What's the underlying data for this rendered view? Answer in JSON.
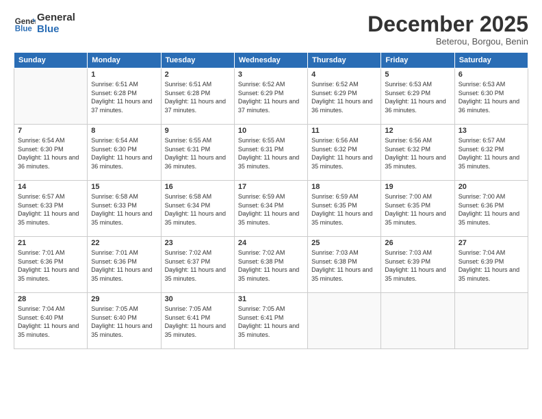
{
  "logo": {
    "general": "General",
    "blue": "Blue"
  },
  "header": {
    "month": "December 2025",
    "location": "Beterou, Borgou, Benin"
  },
  "days_of_week": [
    "Sunday",
    "Monday",
    "Tuesday",
    "Wednesday",
    "Thursday",
    "Friday",
    "Saturday"
  ],
  "weeks": [
    [
      {
        "day": "",
        "info": ""
      },
      {
        "day": "1",
        "info": "Sunrise: 6:51 AM\nSunset: 6:28 PM\nDaylight: 11 hours and 37 minutes."
      },
      {
        "day": "2",
        "info": "Sunrise: 6:51 AM\nSunset: 6:28 PM\nDaylight: 11 hours and 37 minutes."
      },
      {
        "day": "3",
        "info": "Sunrise: 6:52 AM\nSunset: 6:29 PM\nDaylight: 11 hours and 37 minutes."
      },
      {
        "day": "4",
        "info": "Sunrise: 6:52 AM\nSunset: 6:29 PM\nDaylight: 11 hours and 36 minutes."
      },
      {
        "day": "5",
        "info": "Sunrise: 6:53 AM\nSunset: 6:29 PM\nDaylight: 11 hours and 36 minutes."
      },
      {
        "day": "6",
        "info": "Sunrise: 6:53 AM\nSunset: 6:30 PM\nDaylight: 11 hours and 36 minutes."
      }
    ],
    [
      {
        "day": "7",
        "info": "Sunrise: 6:54 AM\nSunset: 6:30 PM\nDaylight: 11 hours and 36 minutes."
      },
      {
        "day": "8",
        "info": "Sunrise: 6:54 AM\nSunset: 6:30 PM\nDaylight: 11 hours and 36 minutes."
      },
      {
        "day": "9",
        "info": "Sunrise: 6:55 AM\nSunset: 6:31 PM\nDaylight: 11 hours and 36 minutes."
      },
      {
        "day": "10",
        "info": "Sunrise: 6:55 AM\nSunset: 6:31 PM\nDaylight: 11 hours and 35 minutes."
      },
      {
        "day": "11",
        "info": "Sunrise: 6:56 AM\nSunset: 6:32 PM\nDaylight: 11 hours and 35 minutes."
      },
      {
        "day": "12",
        "info": "Sunrise: 6:56 AM\nSunset: 6:32 PM\nDaylight: 11 hours and 35 minutes."
      },
      {
        "day": "13",
        "info": "Sunrise: 6:57 AM\nSunset: 6:32 PM\nDaylight: 11 hours and 35 minutes."
      }
    ],
    [
      {
        "day": "14",
        "info": "Sunrise: 6:57 AM\nSunset: 6:33 PM\nDaylight: 11 hours and 35 minutes."
      },
      {
        "day": "15",
        "info": "Sunrise: 6:58 AM\nSunset: 6:33 PM\nDaylight: 11 hours and 35 minutes."
      },
      {
        "day": "16",
        "info": "Sunrise: 6:58 AM\nSunset: 6:34 PM\nDaylight: 11 hours and 35 minutes."
      },
      {
        "day": "17",
        "info": "Sunrise: 6:59 AM\nSunset: 6:34 PM\nDaylight: 11 hours and 35 minutes."
      },
      {
        "day": "18",
        "info": "Sunrise: 6:59 AM\nSunset: 6:35 PM\nDaylight: 11 hours and 35 minutes."
      },
      {
        "day": "19",
        "info": "Sunrise: 7:00 AM\nSunset: 6:35 PM\nDaylight: 11 hours and 35 minutes."
      },
      {
        "day": "20",
        "info": "Sunrise: 7:00 AM\nSunset: 6:36 PM\nDaylight: 11 hours and 35 minutes."
      }
    ],
    [
      {
        "day": "21",
        "info": "Sunrise: 7:01 AM\nSunset: 6:36 PM\nDaylight: 11 hours and 35 minutes."
      },
      {
        "day": "22",
        "info": "Sunrise: 7:01 AM\nSunset: 6:36 PM\nDaylight: 11 hours and 35 minutes."
      },
      {
        "day": "23",
        "info": "Sunrise: 7:02 AM\nSunset: 6:37 PM\nDaylight: 11 hours and 35 minutes."
      },
      {
        "day": "24",
        "info": "Sunrise: 7:02 AM\nSunset: 6:38 PM\nDaylight: 11 hours and 35 minutes."
      },
      {
        "day": "25",
        "info": "Sunrise: 7:03 AM\nSunset: 6:38 PM\nDaylight: 11 hours and 35 minutes."
      },
      {
        "day": "26",
        "info": "Sunrise: 7:03 AM\nSunset: 6:39 PM\nDaylight: 11 hours and 35 minutes."
      },
      {
        "day": "27",
        "info": "Sunrise: 7:04 AM\nSunset: 6:39 PM\nDaylight: 11 hours and 35 minutes."
      }
    ],
    [
      {
        "day": "28",
        "info": "Sunrise: 7:04 AM\nSunset: 6:40 PM\nDaylight: 11 hours and 35 minutes."
      },
      {
        "day": "29",
        "info": "Sunrise: 7:05 AM\nSunset: 6:40 PM\nDaylight: 11 hours and 35 minutes."
      },
      {
        "day": "30",
        "info": "Sunrise: 7:05 AM\nSunset: 6:41 PM\nDaylight: 11 hours and 35 minutes."
      },
      {
        "day": "31",
        "info": "Sunrise: 7:05 AM\nSunset: 6:41 PM\nDaylight: 11 hours and 35 minutes."
      },
      {
        "day": "",
        "info": ""
      },
      {
        "day": "",
        "info": ""
      },
      {
        "day": "",
        "info": ""
      }
    ]
  ]
}
